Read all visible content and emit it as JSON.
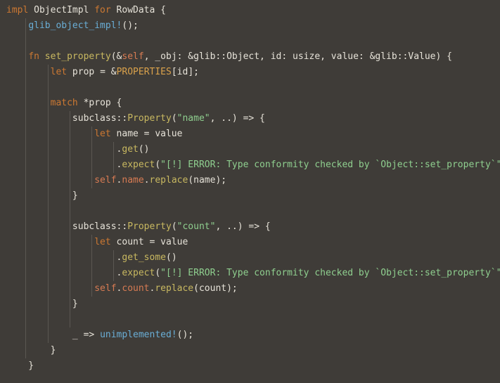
{
  "editor": {
    "colors": {
      "background": "#3f3c38",
      "text": "#e6e2d8",
      "keyword": "#d2a6e1",
      "function": "#c8b860",
      "string": "#8fcf8f",
      "macro": "#6aaed6",
      "self": "#d77b53"
    },
    "lines": [
      [
        {
          "t": "impl",
          "c": "kw2"
        },
        {
          "t": " ObjectImpl ",
          "c": "plain"
        },
        {
          "t": "for",
          "c": "kw2"
        },
        {
          "t": " RowData {",
          "c": "plain"
        }
      ],
      [
        {
          "t": "    ",
          "c": "plain"
        },
        {
          "t": "glib_object_impl!",
          "c": "macro"
        },
        {
          "t": "();",
          "c": "plain"
        }
      ],
      [
        {
          "t": "",
          "c": "plain"
        }
      ],
      [
        {
          "t": "    ",
          "c": "plain"
        },
        {
          "t": "fn",
          "c": "kw2"
        },
        {
          "t": " ",
          "c": "plain"
        },
        {
          "t": "set_property",
          "c": "fn"
        },
        {
          "t": "(&",
          "c": "plain"
        },
        {
          "t": "self",
          "c": "self"
        },
        {
          "t": ", _obj: &glib::Object, id: usize, value: &glib::Value) {",
          "c": "plain"
        }
      ],
      [
        {
          "t": "        ",
          "c": "plain"
        },
        {
          "t": "let",
          "c": "kw2"
        },
        {
          "t": " prop = &",
          "c": "plain"
        },
        {
          "t": "PROPERTIES",
          "c": "const"
        },
        {
          "t": "[id];",
          "c": "plain"
        }
      ],
      [
        {
          "t": "",
          "c": "plain"
        }
      ],
      [
        {
          "t": "        ",
          "c": "plain"
        },
        {
          "t": "match",
          "c": "kw2"
        },
        {
          "t": " *prop {",
          "c": "plain"
        }
      ],
      [
        {
          "t": "            subclass::",
          "c": "plain"
        },
        {
          "t": "Property",
          "c": "fn"
        },
        {
          "t": "(",
          "c": "plain"
        },
        {
          "t": "\"name\"",
          "c": "str"
        },
        {
          "t": ", ..) => {",
          "c": "plain"
        }
      ],
      [
        {
          "t": "                ",
          "c": "plain"
        },
        {
          "t": "let",
          "c": "kw2"
        },
        {
          "t": " name = value",
          "c": "plain"
        }
      ],
      [
        {
          "t": "                    .",
          "c": "plain"
        },
        {
          "t": "get",
          "c": "fn"
        },
        {
          "t": "()",
          "c": "plain"
        }
      ],
      [
        {
          "t": "                    .",
          "c": "plain"
        },
        {
          "t": "expect",
          "c": "fn"
        },
        {
          "t": "(",
          "c": "plain"
        },
        {
          "t": "\"[!] ERROR: Type conformity checked by `Object::set_property`\"",
          "c": "str"
        },
        {
          "t": ");",
          "c": "plain"
        }
      ],
      [
        {
          "t": "                ",
          "c": "plain"
        },
        {
          "t": "self",
          "c": "self"
        },
        {
          "t": ".",
          "c": "plain"
        },
        {
          "t": "name",
          "c": "field"
        },
        {
          "t": ".",
          "c": "plain"
        },
        {
          "t": "replace",
          "c": "fn"
        },
        {
          "t": "(name);",
          "c": "plain"
        }
      ],
      [
        {
          "t": "            }",
          "c": "plain"
        }
      ],
      [
        {
          "t": "",
          "c": "plain"
        }
      ],
      [
        {
          "t": "            subclass::",
          "c": "plain"
        },
        {
          "t": "Property",
          "c": "fn"
        },
        {
          "t": "(",
          "c": "plain"
        },
        {
          "t": "\"count\"",
          "c": "str"
        },
        {
          "t": ", ..) => {",
          "c": "plain"
        }
      ],
      [
        {
          "t": "                ",
          "c": "plain"
        },
        {
          "t": "let",
          "c": "kw2"
        },
        {
          "t": " count = value",
          "c": "plain"
        }
      ],
      [
        {
          "t": "                    .",
          "c": "plain"
        },
        {
          "t": "get_some",
          "c": "fn"
        },
        {
          "t": "()",
          "c": "plain"
        }
      ],
      [
        {
          "t": "                    .",
          "c": "plain"
        },
        {
          "t": "expect",
          "c": "fn"
        },
        {
          "t": "(",
          "c": "plain"
        },
        {
          "t": "\"[!] ERROR: Type conformity checked by `Object::set_property`\"",
          "c": "str"
        },
        {
          "t": ");",
          "c": "plain"
        }
      ],
      [
        {
          "t": "                ",
          "c": "plain"
        },
        {
          "t": "self",
          "c": "self"
        },
        {
          "t": ".",
          "c": "plain"
        },
        {
          "t": "count",
          "c": "field"
        },
        {
          "t": ".",
          "c": "plain"
        },
        {
          "t": "replace",
          "c": "fn"
        },
        {
          "t": "(count);",
          "c": "plain"
        }
      ],
      [
        {
          "t": "            }",
          "c": "plain"
        }
      ],
      [
        {
          "t": "",
          "c": "plain"
        }
      ],
      [
        {
          "t": "            _ => ",
          "c": "plain"
        },
        {
          "t": "unimplemented!",
          "c": "macro"
        },
        {
          "t": "();",
          "c": "plain"
        }
      ],
      [
        {
          "t": "        }",
          "c": "plain"
        }
      ],
      [
        {
          "t": "    }",
          "c": "plain"
        }
      ]
    ]
  }
}
